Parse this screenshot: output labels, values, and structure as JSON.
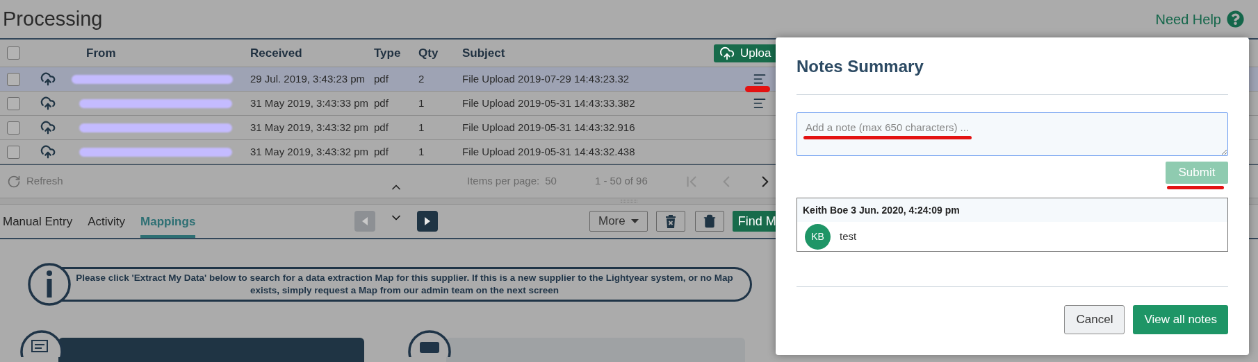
{
  "page": {
    "title": "Processing",
    "help_link": "Need Help"
  },
  "table": {
    "columns": [
      "From",
      "Received",
      "Type",
      "Qty",
      "Subject"
    ],
    "header_checked": false,
    "upload_button": "Uploa",
    "rows": [
      {
        "selected": true,
        "checked": false,
        "received": "29 Jul. 2019, 3:43:23 pm",
        "type": "pdf",
        "qty": "2",
        "subject": "File Upload 2019-07-29 14:43:23.32",
        "has_notes": true
      },
      {
        "selected": false,
        "checked": false,
        "received": "31 May 2019, 3:43:33 pm",
        "type": "pdf",
        "qty": "1",
        "subject": "File Upload 2019-05-31 14:43:33.382",
        "has_notes": true
      },
      {
        "selected": false,
        "checked": false,
        "received": "31 May 2019, 3:43:32 pm",
        "type": "pdf",
        "qty": "1",
        "subject": "File Upload 2019-05-31 14:43:32.916",
        "has_notes": false
      },
      {
        "selected": false,
        "checked": false,
        "received": "31 May 2019, 3:43:32 pm",
        "type": "pdf",
        "qty": "1",
        "subject": "File Upload 2019-05-31 14:43:32.438",
        "has_notes": false
      }
    ]
  },
  "footer": {
    "refresh": "Refresh",
    "items_per_page_label": "Items per page:",
    "items_per_page": "50",
    "range": "1 - 50 of 96",
    "first_disabled": true,
    "prev_disabled": true,
    "next_disabled": false
  },
  "tabs": [
    {
      "label": "Manual Entry",
      "selected": false
    },
    {
      "label": "Activity",
      "selected": false
    },
    {
      "label": "Mappings",
      "selected": true
    }
  ],
  "toolbar": {
    "prev_disabled": true,
    "next_disabled": false,
    "more": "More",
    "find_button": "Find M"
  },
  "info_banner": "Please click 'Extract My Data' below to search for a data extraction Map for this supplier. If this is a new supplier to the Lightyear system, or no Map exists, simply request a Map from our admin team on the next screen",
  "modal": {
    "title": "Notes Summary",
    "note_field": {
      "placeholder": "Add a note (max 650 characters) ..."
    },
    "submit": "Submit",
    "submit_disabled": true,
    "notes": [
      {
        "header": "Keith Boe 3 Jun. 2020, 4:24:09 pm",
        "initials": "KB",
        "text": "test"
      }
    ],
    "buttons": [
      {
        "label": "Cancel",
        "kind": "secondary"
      },
      {
        "label": "View all notes",
        "kind": "primary"
      }
    ]
  }
}
